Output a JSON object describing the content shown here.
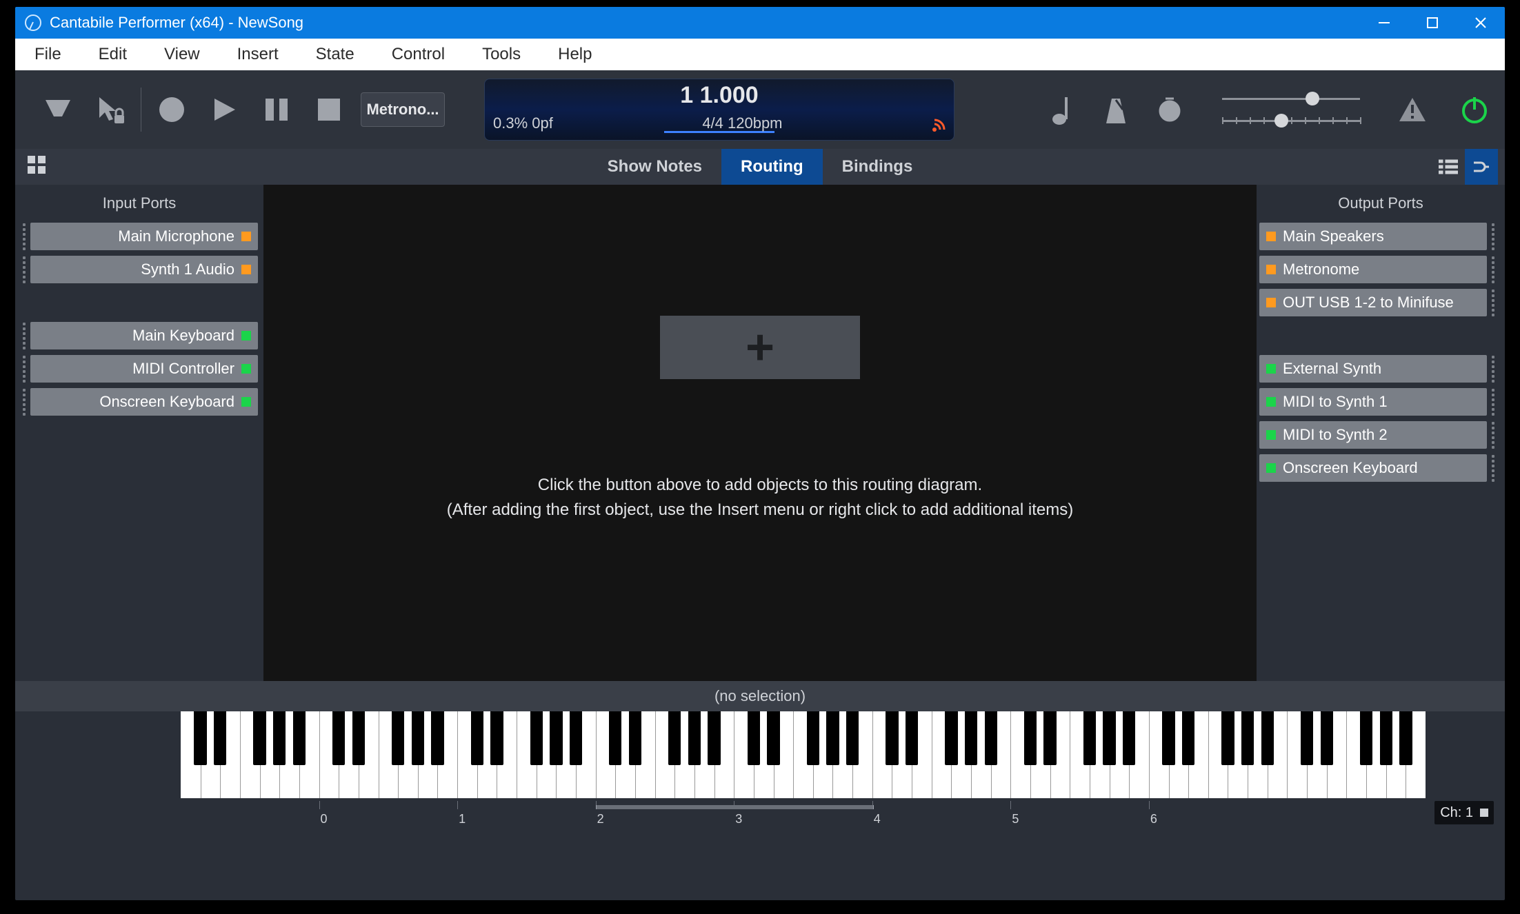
{
  "window": {
    "title": "Cantabile Performer (x64) - NewSong"
  },
  "menu": [
    "File",
    "Edit",
    "View",
    "Insert",
    "State",
    "Control",
    "Tools",
    "Help"
  ],
  "toolbar": {
    "metronome_label": "Metrono...",
    "status": {
      "position": "1 1.000",
      "load": "0.3%  0pf",
      "tempo": "4/4 120bpm"
    },
    "slider1_pos": 0.67,
    "slider2_pos": 0.42
  },
  "tabs": [
    "Show Notes",
    "Routing",
    "Bindings"
  ],
  "active_tab": 1,
  "panels": {
    "input_title": "Input Ports",
    "output_title": "Output Ports",
    "inputs_audio": [
      {
        "label": "Main Microphone",
        "color": "orange"
      },
      {
        "label": "Synth 1 Audio",
        "color": "orange"
      }
    ],
    "inputs_midi": [
      {
        "label": "Main Keyboard",
        "color": "green"
      },
      {
        "label": "MIDI Controller",
        "color": "green"
      },
      {
        "label": "Onscreen Keyboard",
        "color": "green"
      }
    ],
    "outputs_audio": [
      {
        "label": "Main Speakers",
        "color": "orange"
      },
      {
        "label": "Metronome",
        "color": "orange"
      },
      {
        "label": "OUT USB 1-2 to Minifuse",
        "color": "orange"
      }
    ],
    "outputs_midi": [
      {
        "label": "External Synth",
        "color": "green"
      },
      {
        "label": "MIDI to Synth 1",
        "color": "green"
      },
      {
        "label": "MIDI to Synth 2",
        "color": "green"
      },
      {
        "label": "Onscreen Keyboard",
        "color": "green"
      }
    ]
  },
  "center": {
    "hint1": "Click the button above to add objects to this routing diagram.",
    "hint2": "(After adding the first object, use the Insert menu or right click to add additional items)"
  },
  "selection_bar": "(no selection)",
  "keyboard": {
    "octave_labels": [
      "0",
      "1",
      "2",
      "3",
      "4",
      "5",
      "6"
    ],
    "active_range": [
      2,
      4
    ],
    "channel": "Ch: 1"
  }
}
